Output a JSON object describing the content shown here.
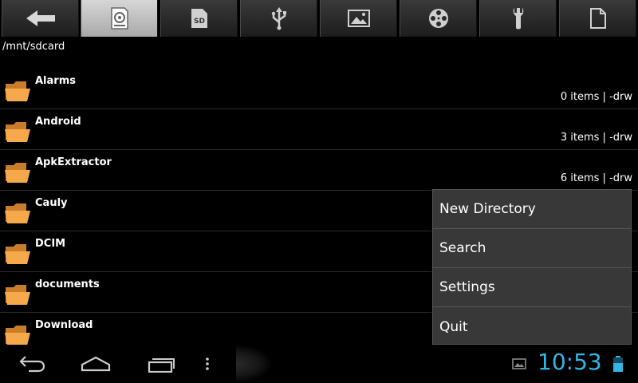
{
  "toolbar": {
    "buttons": [
      {
        "icon": "back-arrow-icon"
      },
      {
        "icon": "internal-storage-icon",
        "active": true
      },
      {
        "icon": "sd-card-icon",
        "label": "SD"
      },
      {
        "icon": "usb-icon"
      },
      {
        "icon": "image-icon"
      },
      {
        "icon": "video-icon"
      },
      {
        "icon": "wrench-icon"
      },
      {
        "icon": "document-icon"
      }
    ]
  },
  "path": "/mnt/sdcard",
  "files": [
    {
      "name": "Alarms",
      "meta": "0 items | -drw"
    },
    {
      "name": "Android",
      "meta": "3 items | -drw"
    },
    {
      "name": "ApkExtractor",
      "meta": "6 items | -drw"
    },
    {
      "name": "Cauly",
      "meta": ""
    },
    {
      "name": "DCIM",
      "meta": ""
    },
    {
      "name": "documents",
      "meta": ""
    },
    {
      "name": "Download",
      "meta": ""
    }
  ],
  "menu": {
    "items": [
      "New Directory",
      "Search",
      "Settings",
      "Quit"
    ]
  },
  "statusbar": {
    "time": "10:53",
    "accent_color": "#33b5e5"
  }
}
